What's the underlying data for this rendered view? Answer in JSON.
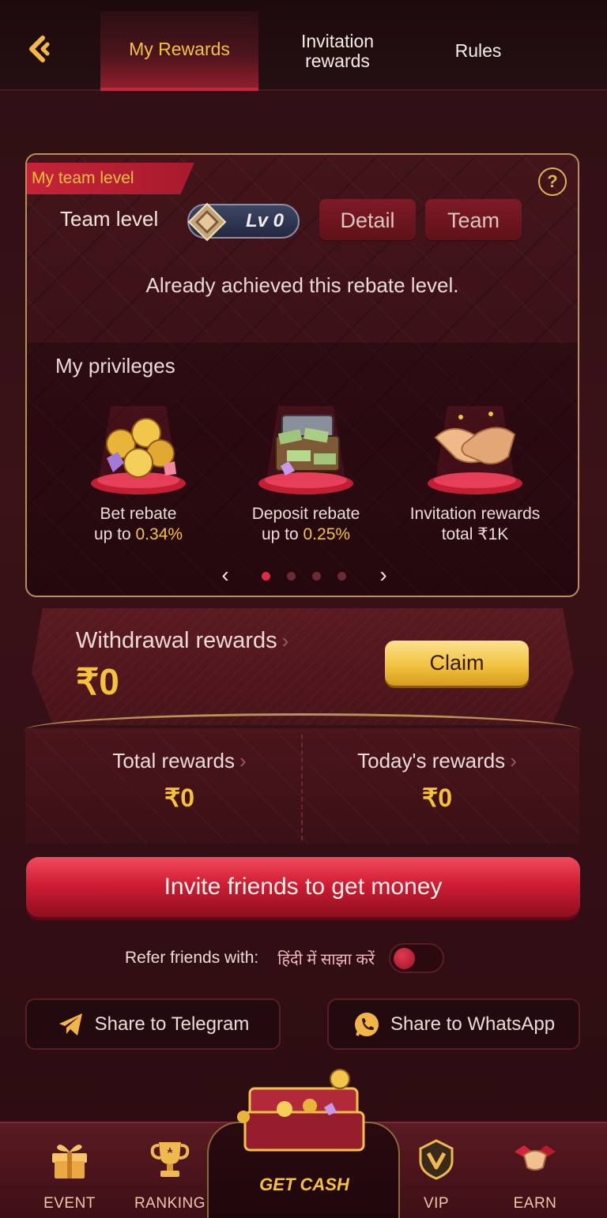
{
  "header": {
    "tabs": [
      {
        "label": "My Rewards",
        "active": true
      },
      {
        "label": "Invitation\nrewards",
        "active": false
      },
      {
        "label": "Rules",
        "active": false
      }
    ]
  },
  "team": {
    "ribbon": "My team level",
    "level_label": "Team level",
    "level_badge": "Lv 0",
    "detail_button": "Detail",
    "team_button": "Team",
    "status": "Already achieved this rebate level."
  },
  "privileges": {
    "title": "My privileges",
    "items": [
      {
        "line1": "Bet rebate",
        "line2_prefix": "up to ",
        "line2_value": "0.34%"
      },
      {
        "line1": "Deposit rebate",
        "line2_prefix": "up to ",
        "line2_value": "0.25%"
      },
      {
        "line1": "Invitation rewards",
        "line2_prefix": "total ",
        "line2_value": "₹1K"
      }
    ],
    "pager": {
      "pages": 4,
      "current": 1
    }
  },
  "withdrawal": {
    "label": "Withdrawal rewards",
    "amount": "₹0",
    "claim_button": "Claim"
  },
  "rewards": {
    "total_label": "Total rewards",
    "total_value": "₹0",
    "today_label": "Today's rewards",
    "today_value": "₹0"
  },
  "invite_button": "Invite friends to get money",
  "refer": {
    "label": "Refer friends with:",
    "hindi": "हिंदी में साझा करें",
    "toggle_on": false
  },
  "share": {
    "telegram": "Share to Telegram",
    "whatsapp": "Share to WhatsApp"
  },
  "bottom_nav": {
    "event": "EVENT",
    "ranking": "RANKING",
    "get_cash": "GET CASH",
    "vip": "VIP",
    "earn": "EARN"
  },
  "colors": {
    "accent_gold": "#f5c23a",
    "accent_red": "#d01d34",
    "background": "#2a0d11"
  }
}
